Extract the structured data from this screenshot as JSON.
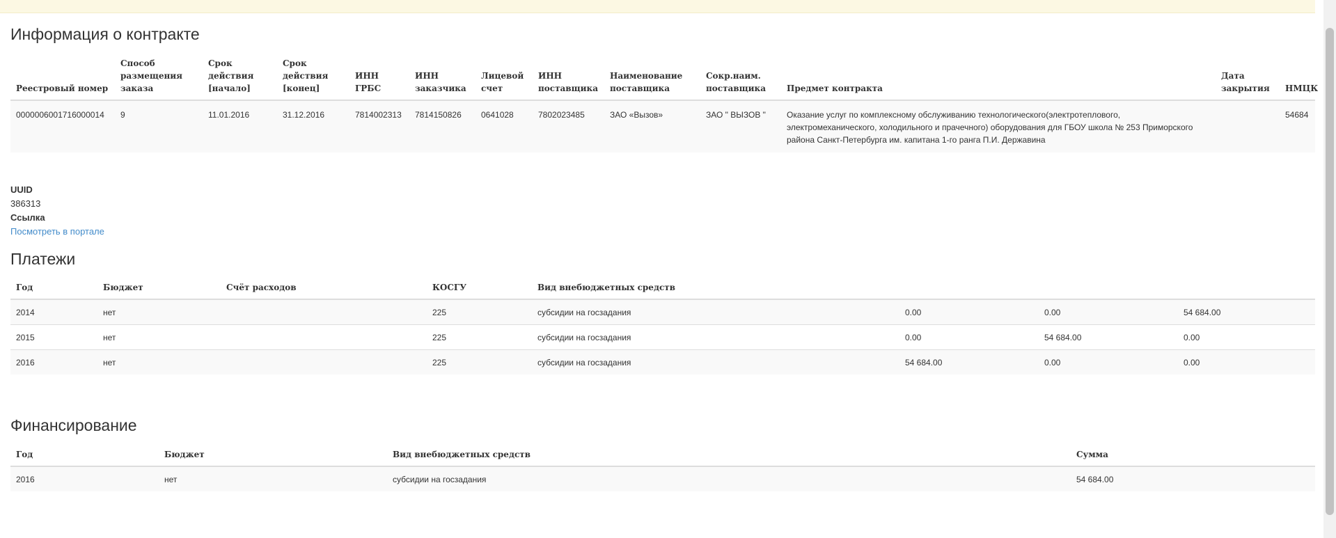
{
  "banner": {
    "text": ""
  },
  "contract": {
    "heading": "Информация о контракте",
    "columns": [
      "Реестровый номер",
      "Способ размещения заказа",
      "Срок действия [начало]",
      "Срок действия [конец]",
      "ИНН ГРБС",
      "ИНН заказчика",
      "Лицевой счет",
      "ИНН поставщика",
      "Наименование поставщика",
      "Сокр.наим. поставщика",
      "Предмет контракта",
      "Дата закрытия",
      "НМЦК"
    ],
    "row": {
      "reg_number": "0000006001716000014",
      "method": "9",
      "start": "11.01.2016",
      "end": "31.12.2016",
      "inn_grbs": "7814002313",
      "inn_customer": "7814150826",
      "account": "0641028",
      "inn_supplier": "7802023485",
      "supplier_name": "ЗАО «Вызов»",
      "supplier_short": "ЗАО \" ВЫЗОВ \"",
      "subject": "Оказание услуг по комплексному обслуживанию технологического(электротеплового, электромеханического, холодильного и прачечного) оборудования для ГБОУ школа № 253 Приморского района Санкт-Петербурга им. капитана 1-го ранга П.И. Державина",
      "close_date": "",
      "nmck": "54684"
    }
  },
  "info": {
    "uuid_label": "UUID",
    "uuid_value": "386313",
    "link_label": "Ссылка",
    "link_text": "Посмотреть в портале"
  },
  "payments": {
    "heading": "Платежи",
    "columns": [
      "Год",
      "Бюджет",
      "Счёт расходов",
      "КОСГУ",
      "Вид внебюджетных средств",
      "",
      "",
      ""
    ],
    "rows": [
      {
        "year": "2014",
        "budget": "нет",
        "account": "",
        "kosgu": "225",
        "kind": "субсидии на госзадания",
        "a": "0.00",
        "b": "0.00",
        "c": "54 684.00"
      },
      {
        "year": "2015",
        "budget": "нет",
        "account": "",
        "kosgu": "225",
        "kind": "субсидии на госзадания",
        "a": "0.00",
        "b": "54 684.00",
        "c": "0.00"
      },
      {
        "year": "2016",
        "budget": "нет",
        "account": "",
        "kosgu": "225",
        "kind": "субсидии на госзадания",
        "a": "54 684.00",
        "b": "0.00",
        "c": "0.00"
      }
    ]
  },
  "financing": {
    "heading": "Финансирование",
    "columns": [
      "Год",
      "Бюджет",
      "Вид внебюджетных средств",
      "Сумма"
    ],
    "rows": [
      {
        "year": "2016",
        "budget": "нет",
        "kind": "субсидии на госзадания",
        "sum": "54 684.00"
      }
    ]
  },
  "next_section": {
    "heading": ""
  },
  "colors": {
    "link": "#428bca",
    "banner": "#fcf8e3",
    "stripe": "#f9f9f9",
    "border": "#dddddd"
  }
}
